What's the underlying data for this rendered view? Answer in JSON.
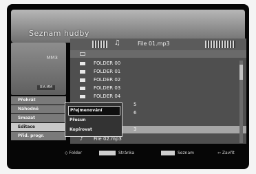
{
  "header": {
    "title": "Seznam hudby"
  },
  "tabbar": {
    "note_icon": "♫",
    "file_label": "File 01.mp3"
  },
  "left_panel": {
    "count_label": "MM3",
    "small_label": "RM.MM"
  },
  "list": {
    "items": [
      {
        "label": "",
        "type": "up"
      },
      {
        "label": "FOLDER 00",
        "type": "folder"
      },
      {
        "label": "FOLDER 01",
        "type": "folder"
      },
      {
        "label": "FOLDER 02",
        "type": "folder"
      },
      {
        "label": "FOLDER 03",
        "type": "folder"
      },
      {
        "label": "FOLDER 04",
        "type": "folder"
      },
      {
        "label": "5",
        "type": "folder"
      },
      {
        "label": "6",
        "type": "folder"
      },
      {
        "label": "3",
        "type": "file"
      },
      {
        "label": "File 02.mp3",
        "type": "file"
      }
    ]
  },
  "menu": {
    "items": [
      "Přehrát",
      "Náhodně",
      "Smazat",
      "Editace",
      "Přid. progr."
    ]
  },
  "popup": {
    "items": [
      "Přejmenování",
      "Přesun",
      "Kopírovat"
    ]
  },
  "footer": {
    "folder": "◇ Folder",
    "page": "Stránka",
    "list": "Seznam",
    "back": "⇦ Zavřít"
  }
}
